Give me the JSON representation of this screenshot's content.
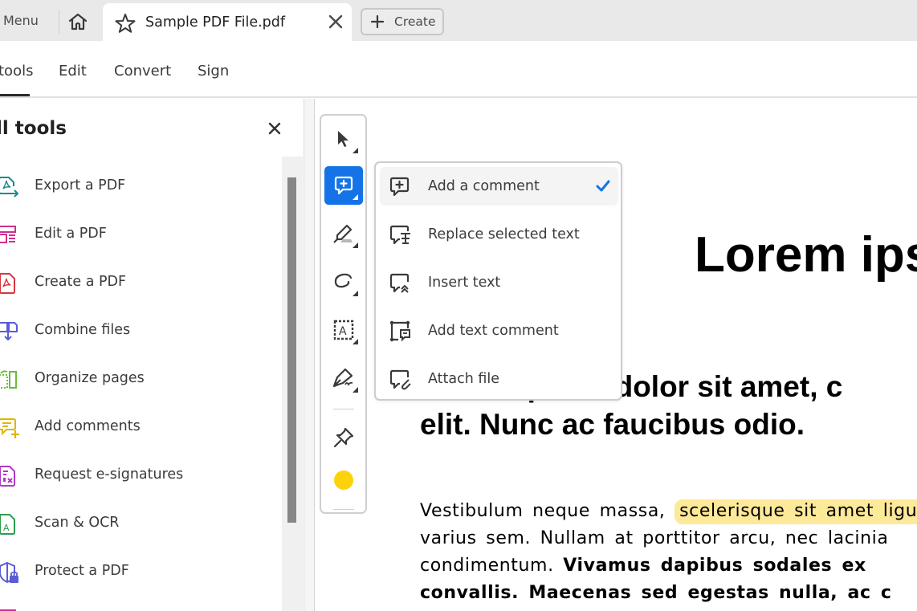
{
  "tabbar": {
    "menu_label": "Menu",
    "home_icon": "home-icon",
    "doc_tab": {
      "title": "Sample PDF File.pdf",
      "star_icon": "star-icon",
      "close_icon": "close-icon"
    },
    "create_label": "Create",
    "create_icon": "plus-icon"
  },
  "topnav": {
    "items": [
      {
        "label": "All tools",
        "visible_label": "tools",
        "active": true
      },
      {
        "label": "Edit",
        "active": false
      },
      {
        "label": "Convert",
        "active": false
      },
      {
        "label": "Sign",
        "active": false
      }
    ]
  },
  "leftpanel": {
    "title": "All tools",
    "visible_title": "ll tools",
    "close_icon": "close-icon",
    "tools": [
      {
        "label": "Export a PDF",
        "icon": "export-pdf-icon",
        "color": "#1b8a8f"
      },
      {
        "label": "Edit a PDF",
        "icon": "edit-pdf-icon",
        "color": "#d12f8c"
      },
      {
        "label": "Create a PDF",
        "icon": "create-pdf-icon",
        "color": "#d7373f"
      },
      {
        "label": "Combine files",
        "icon": "combine-files-icon",
        "color": "#5b5bd6"
      },
      {
        "label": "Organize pages",
        "icon": "organize-pages-icon",
        "color": "#6bbd3c"
      },
      {
        "label": "Add comments",
        "icon": "add-comments-icon",
        "color": "#e0b50a"
      },
      {
        "label": "Request e-signatures",
        "icon": "request-esignatures-icon",
        "color": "#b03ac4"
      },
      {
        "label": "Scan & OCR",
        "icon": "scan-ocr-icon",
        "color": "#2d9d4e"
      },
      {
        "label": "Protect a PDF",
        "icon": "protect-pdf-icon",
        "color": "#5b5bd6"
      }
    ]
  },
  "vtoolbar": {
    "tools": [
      {
        "name": "select",
        "icon": "pointer-icon",
        "active": false
      },
      {
        "name": "comment",
        "icon": "comment-add-icon",
        "active": true
      },
      {
        "name": "highlight",
        "icon": "highlighter-icon",
        "active": false
      },
      {
        "name": "draw",
        "icon": "freehand-icon",
        "active": false
      },
      {
        "name": "text-box",
        "icon": "text-box-icon",
        "active": false
      },
      {
        "name": "sign",
        "icon": "pen-sign-icon",
        "active": false
      },
      {
        "name": "pin",
        "icon": "pin-icon",
        "active": false
      },
      {
        "name": "color",
        "icon": "color-swatch-icon",
        "active": false
      }
    ],
    "active_color": "#fcd20b",
    "accent": "#1473e6"
  },
  "dropdown": {
    "items": [
      {
        "label": "Add a comment",
        "icon": "comment-add-icon",
        "selected": true
      },
      {
        "label": "Replace selected text",
        "icon": "replace-text-icon",
        "selected": false
      },
      {
        "label": "Insert text",
        "icon": "insert-text-icon",
        "selected": false
      },
      {
        "label": "Add text comment",
        "icon": "text-comment-icon",
        "selected": false
      },
      {
        "label": "Attach file",
        "icon": "attach-file-icon",
        "selected": false
      }
    ],
    "check_icon": "checkmark-icon"
  },
  "document": {
    "heading": "Lorem ips",
    "subheading_line1": "Lorem ipsum dolor sit amet, c",
    "subheading_line2": "elit. Nunc ac faucibus odio.",
    "body": {
      "line1_plain": "Vestibulum neque massa, ",
      "line1_highlight": "scelerisque sit amet ligu",
      "line2": "varius sem. Nullam at porttitor arcu, nec lacinia",
      "line3_plain": "condimentum. ",
      "line3_bold": "Vivamus dapibus sodales ex",
      "line4_bold": "convallis. Maecenas sed egestas nulla, ac c"
    },
    "highlight_color": "#fde99a"
  }
}
